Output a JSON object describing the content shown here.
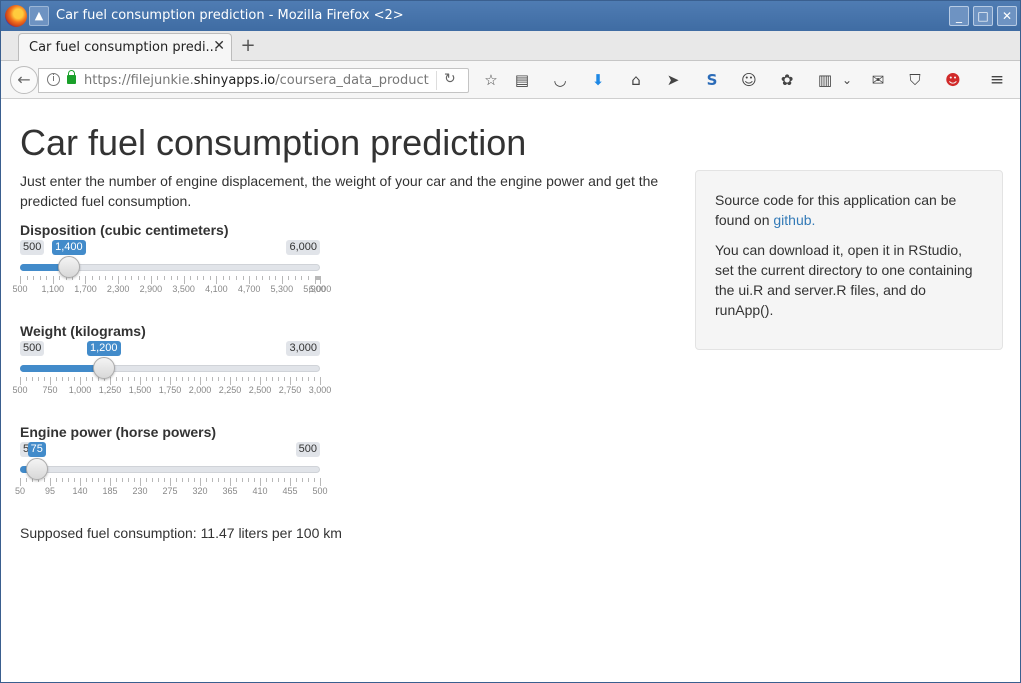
{
  "window": {
    "title": "Car fuel consumption prediction - Mozilla Firefox <2>",
    "controls": [
      "minimize",
      "maximize",
      "close"
    ]
  },
  "tab": {
    "label": "Car fuel consumption predi...",
    "close": "✕",
    "new_tab": "+"
  },
  "navbar": {
    "url_prefix": "https://filejunkie.",
    "url_domain": "shinyapps.io",
    "url_path": "/coursera_data_product",
    "icons": [
      "bookmark-star-icon",
      "reader-view-icon",
      "pocket-icon",
      "download-icon",
      "home-icon",
      "send-icon",
      "s-extension-icon",
      "smiley-icon",
      "puzzle-icon",
      "clipboard-icon",
      "chevron-down-icon",
      "mail-icon",
      "ublock-icon",
      "devil-icon",
      "hamburger-menu-icon"
    ]
  },
  "page": {
    "title": "Car fuel consumption prediction",
    "intro": "Just enter the number of engine displacement, the weight of your car and the engine power and get the predicted fuel consumption.",
    "sliders": [
      {
        "label": "Disposition (cubic centimeters)",
        "min_label": "500",
        "max_label": "6,000",
        "value_label": "1,400",
        "min": 500,
        "max": 6000,
        "value": 1400,
        "tick_labels": [
          "500",
          "1,100",
          "1,700",
          "2,300",
          "2,900",
          "3,500",
          "4,100",
          "4,700",
          "5,300",
          "5,900",
          "6,000"
        ]
      },
      {
        "label": "Weight (kilograms)",
        "min_label": "500",
        "max_label": "3,000",
        "value_label": "1,200",
        "min": 500,
        "max": 3000,
        "value": 1200,
        "tick_labels": [
          "500",
          "750",
          "1,000",
          "1,250",
          "1,500",
          "1,750",
          "2,000",
          "2,250",
          "2,500",
          "2,750",
          "3,000"
        ]
      },
      {
        "label": "Engine power (horse powers)",
        "min_label": "50",
        "max_label": "500",
        "value_label": "75",
        "min": 50,
        "max": 500,
        "value": 75,
        "tick_labels": [
          "50",
          "95",
          "140",
          "185",
          "230",
          "275",
          "320",
          "365",
          "410",
          "455",
          "500"
        ]
      }
    ],
    "result": "Supposed fuel consumption: 11.47 liters per 100 km",
    "sidebar": {
      "p1_text": "Source code for this application can be found on ",
      "p1_link": "github.",
      "p2_text": "You can download it, open it in RStudio, set the current directory to one containing the ui.R and server.R files, and do runApp()."
    }
  },
  "colors": {
    "accent": "#428bca",
    "titlebar": "#4f7cb3",
    "link": "#337ab7"
  }
}
